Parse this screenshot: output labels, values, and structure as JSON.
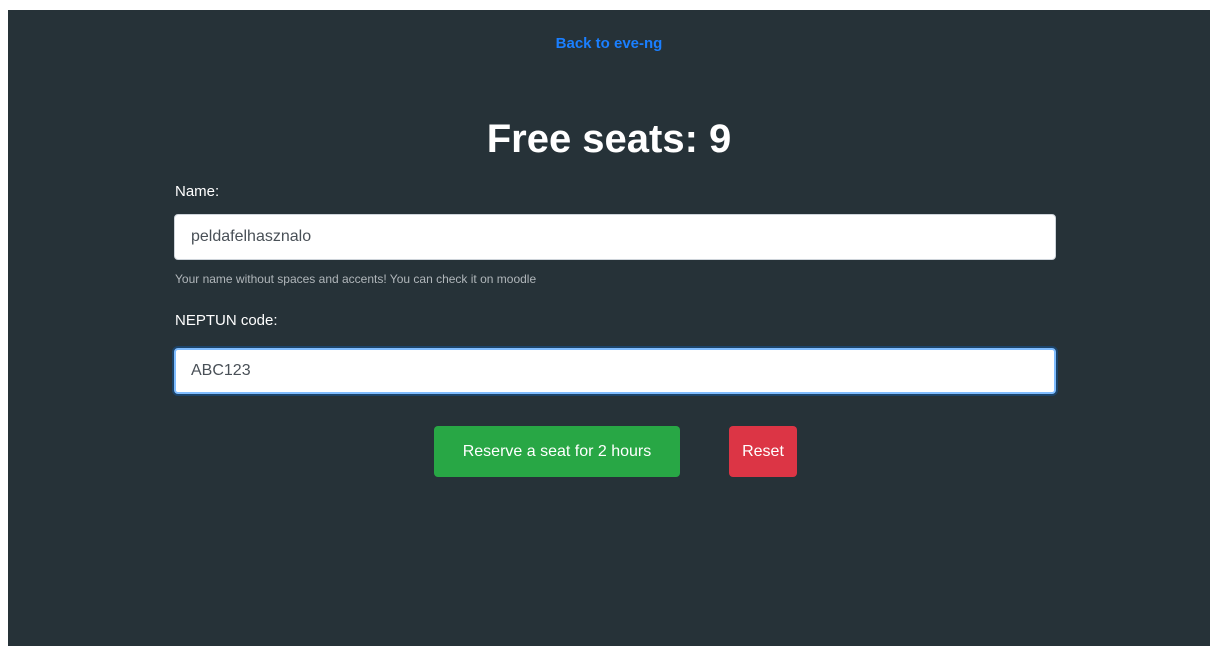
{
  "header": {
    "back_link": "Back to eve-ng"
  },
  "main": {
    "title": "Free seats: 9",
    "form": {
      "name_label": "Name:",
      "name_value": "peldafelhasznalo",
      "name_help": "Your name without spaces and accents! You can check it on moodle",
      "neptun_label": "NEPTUN code:",
      "neptun_value": "ABC123",
      "reserve_button": "Reserve a seat for 2 hours",
      "reset_button": "Reset"
    }
  },
  "colors": {
    "background": "#263238",
    "link": "#1a7fff",
    "reserve": "#28a745",
    "reset": "#dc3545"
  }
}
